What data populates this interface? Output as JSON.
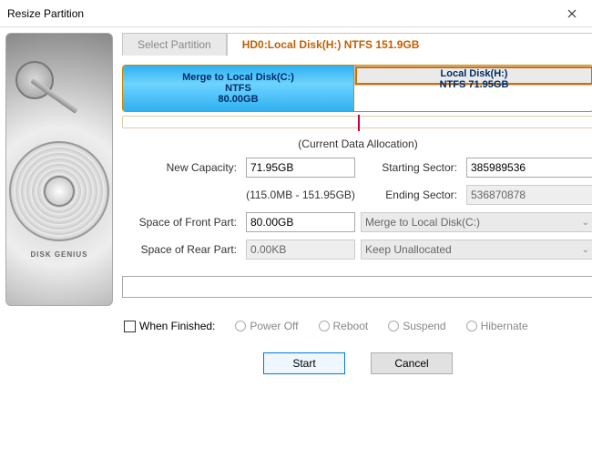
{
  "window": {
    "title": "Resize Partition"
  },
  "tabs": {
    "select_label": "Select Partition",
    "active_label": "HD0:Local Disk(H:) NTFS 151.9GB"
  },
  "disk_segments": [
    {
      "title": "Merge to Local Disk(C:)",
      "sub1": "NTFS",
      "sub2": "80.00GB"
    },
    {
      "title": "Local Disk(H:)",
      "sub1": "NTFS 71.95GB",
      "sub2": ""
    }
  ],
  "allocation_caption": "(Current Data Allocation)",
  "form": {
    "new_capacity_label": "New Capacity:",
    "new_capacity_value": "71.95GB",
    "range_hint": "(115.0MB - 151.95GB)",
    "starting_sector_label": "Starting Sector:",
    "starting_sector_value": "385989536",
    "ending_sector_label": "Ending Sector:",
    "ending_sector_value": "536870878",
    "front_label": "Space of Front Part:",
    "front_value": "80.00GB",
    "front_select": "Merge to Local Disk(C:)",
    "rear_label": "Space of Rear Part:",
    "rear_value": "0.00KB",
    "rear_select": "Keep Unallocated"
  },
  "finish": {
    "checkbox_label": "When Finished:",
    "options": [
      "Power Off",
      "Reboot",
      "Suspend",
      "Hibernate"
    ]
  },
  "buttons": {
    "start": "Start",
    "cancel": "Cancel"
  },
  "sidebar_brand": "DISK GENIUS"
}
